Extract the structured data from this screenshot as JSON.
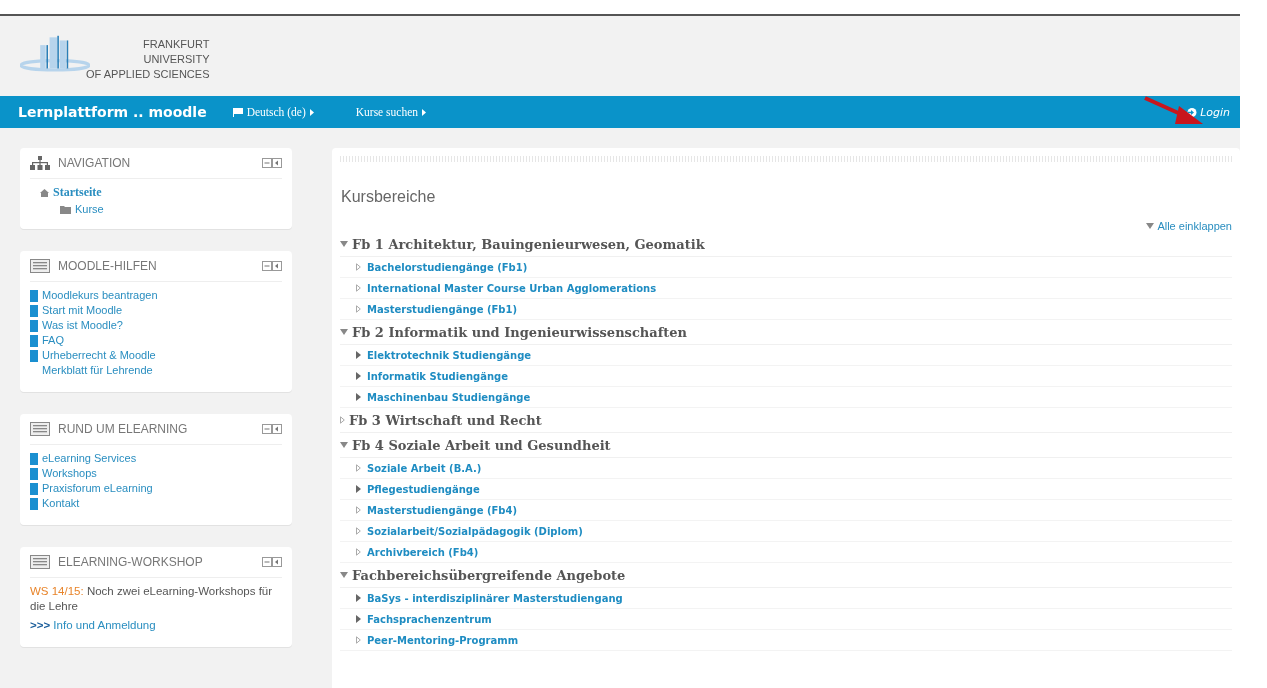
{
  "header": {
    "logo_lines": [
      "FRANKFURT",
      "UNIVERSITY",
      "OF APPLIED SCIENCES"
    ]
  },
  "navbar": {
    "brand": "Lernplattform .. moodle",
    "menus": [
      {
        "label": "Deutsch (de)",
        "flag": true
      },
      {
        "label": "Kurse suchen",
        "flag": false
      }
    ],
    "login": "Login"
  },
  "sidebar": [
    {
      "kind": "navigation",
      "title": "NAVIGATION",
      "items": [
        {
          "label": "Startseite",
          "children": [
            {
              "label": "Kurse"
            }
          ]
        }
      ]
    },
    {
      "kind": "links",
      "title": "MOODLE-HILFEN",
      "links": [
        {
          "label": "Moodlekurs beantragen",
          "bullet": true
        },
        {
          "label": "Start mit Moodle",
          "bullet": true
        },
        {
          "label": "Was ist Moodle?",
          "bullet": true
        },
        {
          "label": "FAQ",
          "bullet": true
        },
        {
          "label": "Urheberrecht & Moodle",
          "bullet": true
        },
        {
          "label": "Merkblatt für Lehrende",
          "bullet": false
        }
      ]
    },
    {
      "kind": "links",
      "title": "RUND UM ELEARNING",
      "links": [
        {
          "label": "eLearning Services",
          "bullet": true
        },
        {
          "label": "Workshops",
          "bullet": true
        },
        {
          "label": "Praxisforum eLearning",
          "bullet": true
        },
        {
          "label": "Kontakt",
          "bullet": true
        }
      ]
    },
    {
      "kind": "text",
      "title": "ELEARNING-WORKSHOP",
      "highlight": "WS 14/15:",
      "text": "Noch zwei eLearning-Workshops für die Lehre",
      "link_prefix": ">>>",
      "link": "Info und Anmeldung"
    }
  ],
  "main": {
    "heading": "Kursbereiche",
    "collapse_all": "Alle einklappen",
    "categories": [
      {
        "label": "Fb 1 Architektur, Bauingenieurwesen, Geomatik",
        "expanded": true,
        "children": [
          {
            "label": "Bachelorstudiengänge (Fb1)",
            "has_children": false
          },
          {
            "label": "International Master Course Urban Agglomerations",
            "has_children": false
          },
          {
            "label": "Masterstudiengänge (Fb1)",
            "has_children": false
          }
        ]
      },
      {
        "label": "Fb 2 Informatik und Ingenieurwissenschaften",
        "expanded": true,
        "children": [
          {
            "label": "Elektrotechnik Studiengänge",
            "has_children": true
          },
          {
            "label": "Informatik Studiengänge",
            "has_children": true
          },
          {
            "label": "Maschinenbau Studiengänge",
            "has_children": true
          }
        ]
      },
      {
        "label": "Fb 3 Wirtschaft und Recht",
        "expanded": false
      },
      {
        "label": "Fb 4 Soziale Arbeit und Gesundheit",
        "expanded": true,
        "children": [
          {
            "label": "Soziale Arbeit (B.A.)",
            "has_children": false
          },
          {
            "label": "Pflegestudiengänge",
            "has_children": true
          },
          {
            "label": "Masterstudiengänge (Fb4)",
            "has_children": false
          },
          {
            "label": "Sozialarbeit/Sozialpädagogik (Diplom)",
            "has_children": false
          },
          {
            "label": "Archivbereich (Fb4)",
            "has_children": false
          }
        ]
      },
      {
        "label": "Fachbereichsübergreifende Angebote",
        "expanded": true,
        "children": [
          {
            "label": "BaSys - interdisziplinärer Masterstudiengang",
            "has_children": true
          },
          {
            "label": "Fachsprachenzentrum",
            "has_children": true
          },
          {
            "label": "Peer-Mentoring-Programm",
            "has_children": false
          }
        ]
      }
    ]
  }
}
